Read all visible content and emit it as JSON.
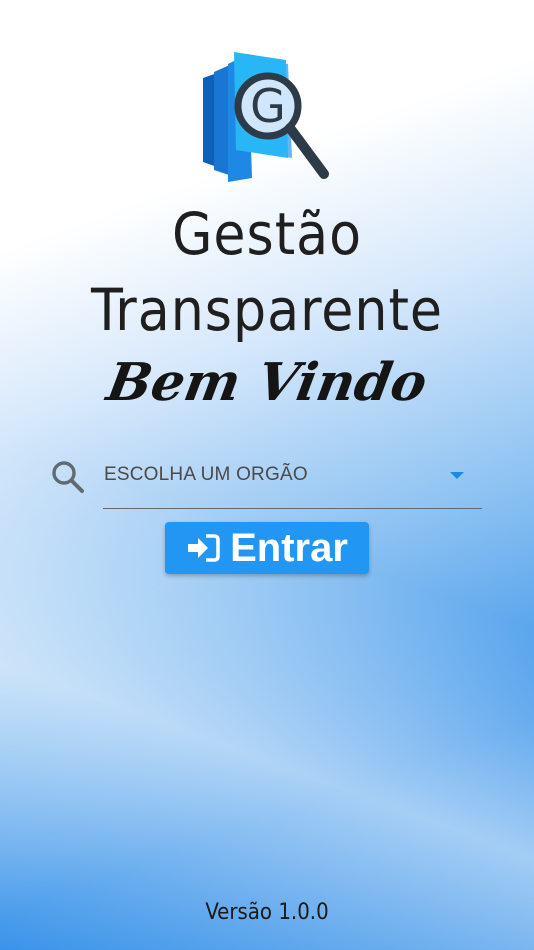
{
  "app": {
    "title_line1": "Gestão",
    "title_line2": "Transparente",
    "welcome": "Bem Vindo",
    "logo_icon": "gt-logo-icon"
  },
  "selector": {
    "label": "ESCOLHA UM ORGÃO",
    "search_icon": "search-icon",
    "arrow_icon": "dropdown-arrow-icon"
  },
  "login_button": {
    "label": "Entrar",
    "icon": "sign-in-icon",
    "color": "#2196f3"
  },
  "footer": {
    "version": "Versão 1.0.0"
  },
  "colors": {
    "accent": "#2196f3",
    "gradient_bottom": "#2c8be6"
  }
}
